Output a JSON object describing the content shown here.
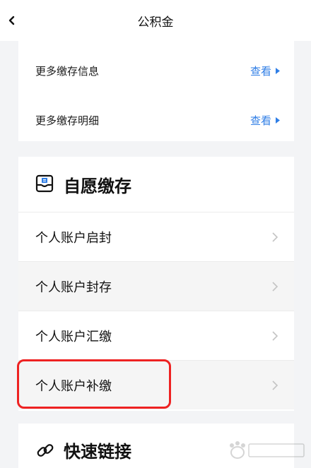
{
  "navbar": {
    "title": "公积金",
    "back_icon": "chevron-left-icon"
  },
  "info_card": {
    "rows": [
      {
        "label": "更多缴存信息",
        "link": "查看"
      },
      {
        "label": "更多缴存明细",
        "link": "查看"
      }
    ],
    "link_color": "#2f7ee6"
  },
  "voluntary": {
    "title": "自愿缴存",
    "icon": "inbox-icon",
    "items": [
      {
        "label": "个人账户启封"
      },
      {
        "label": "个人账户封存"
      },
      {
        "label": "个人账户汇缴"
      },
      {
        "label": "个人账户补缴"
      }
    ]
  },
  "quick_links": {
    "title": "快速链接",
    "icon": "link-icon"
  },
  "highlight_color": "#ee2222"
}
